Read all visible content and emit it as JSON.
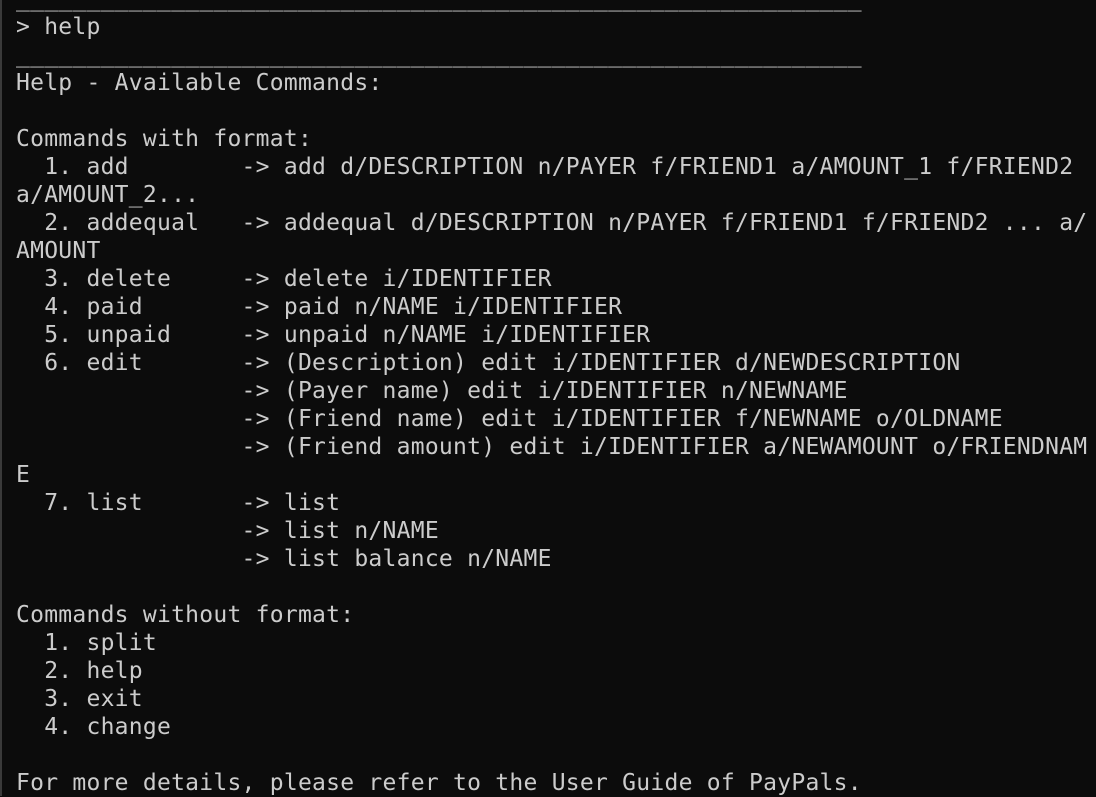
{
  "terminal": {
    "lines": [
      "____________________________________________________________",
      "> help",
      "____________________________________________________________",
      "Help - Available Commands:",
      "",
      "Commands with format:",
      "  1. add        -> add d/DESCRIPTION n/PAYER f/FRIEND1 a/AMOUNT_1 f/FRIEND2",
      "a/AMOUNT_2...",
      "  2. addequal   -> addequal d/DESCRIPTION n/PAYER f/FRIEND1 f/FRIEND2 ... a/",
      "AMOUNT",
      "  3. delete     -> delete i/IDENTIFIER",
      "  4. paid       -> paid n/NAME i/IDENTIFIER",
      "  5. unpaid     -> unpaid n/NAME i/IDENTIFIER",
      "  6. edit       -> (Description) edit i/IDENTIFIER d/NEWDESCRIPTION",
      "                -> (Payer name) edit i/IDENTIFIER n/NEWNAME",
      "                -> (Friend name) edit i/IDENTIFIER f/NEWNAME o/OLDNAME",
      "                -> (Friend amount) edit i/IDENTIFIER a/NEWAMOUNT o/FRIENDNAM",
      "E",
      "  7. list       -> list",
      "                -> list n/NAME",
      "                -> list balance n/NAME",
      "",
      "Commands without format:",
      "  1. split",
      "  2. help",
      "  3. exit",
      "  4. change",
      "",
      "For more details, please refer to the User Guide of PayPals."
    ]
  }
}
